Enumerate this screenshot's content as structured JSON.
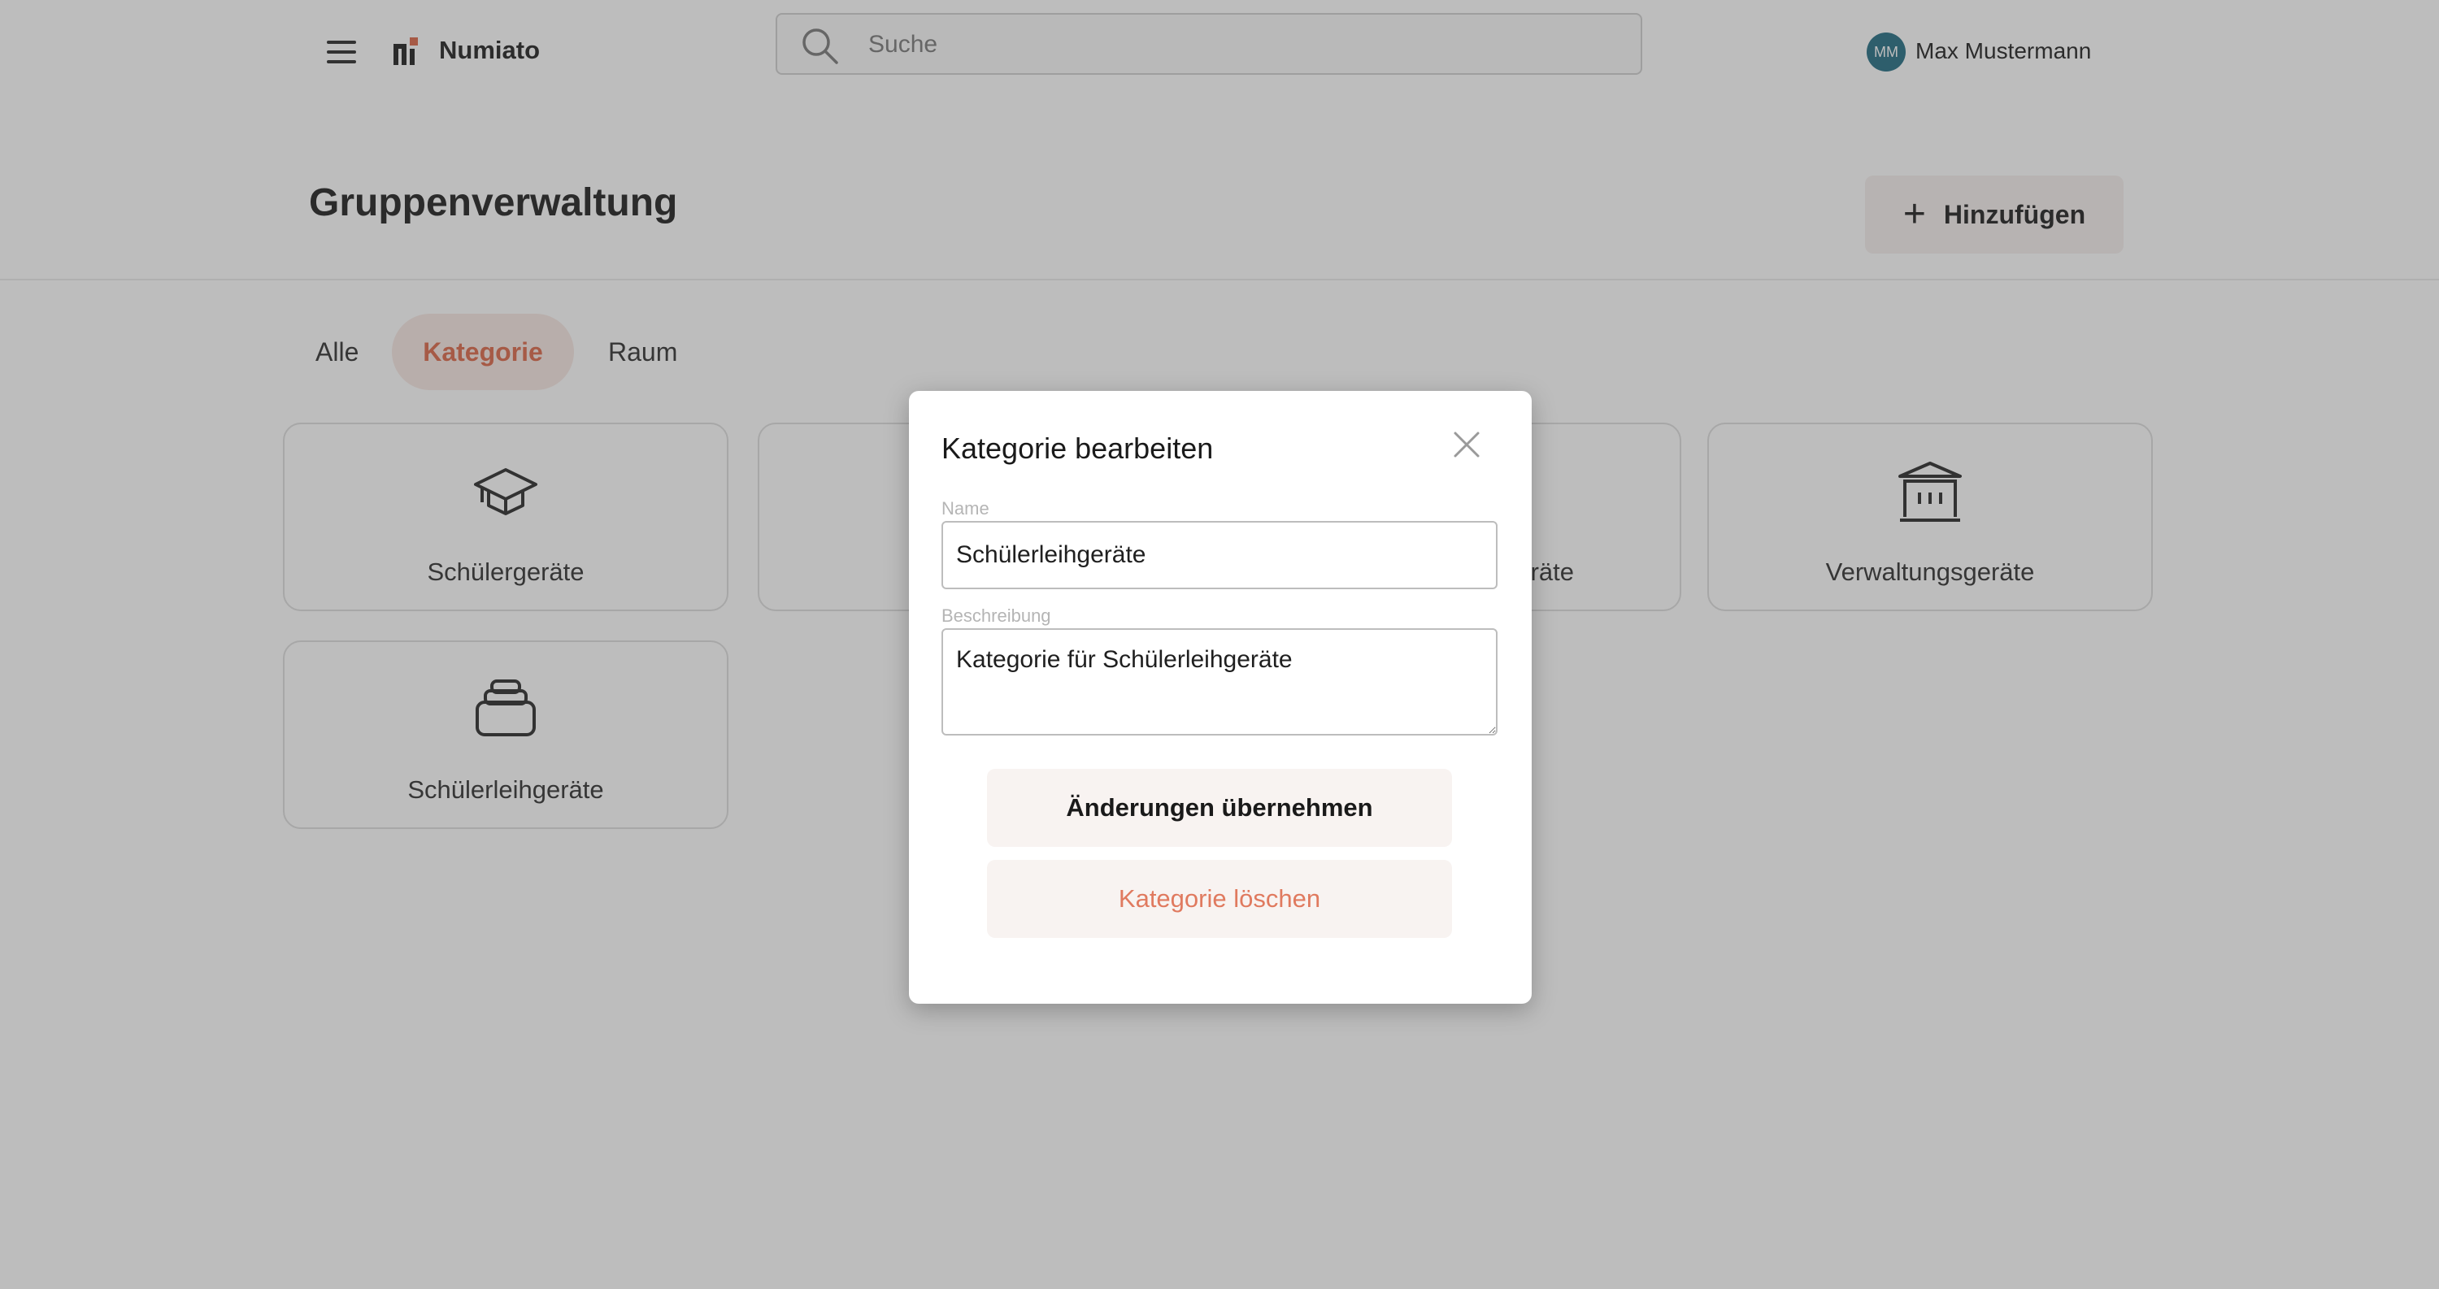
{
  "header": {
    "app_title": "Numiato",
    "search_placeholder": "Suche",
    "user": {
      "initials": "MM",
      "name": "Max Mustermann",
      "avatar_color": "#3f7f92"
    }
  },
  "page": {
    "title": "Gruppenverwaltung",
    "add_button_label": "Hinzufügen"
  },
  "tabs": [
    {
      "label": "Alle",
      "active": false
    },
    {
      "label": "Kategorie",
      "active": true
    },
    {
      "label": "Raum",
      "active": false
    }
  ],
  "cards": [
    {
      "label": "Schülergeräte",
      "icon": "graduation-cap-icon"
    },
    {
      "label": "",
      "icon": ""
    },
    {
      "label": "räte",
      "icon": ""
    },
    {
      "label": "Verwaltungsgeräte",
      "icon": "building-icon"
    },
    {
      "label": "Schülerleihgeräte",
      "icon": "device-stack-icon"
    }
  ],
  "modal": {
    "title": "Kategorie bearbeiten",
    "name_label": "Name",
    "name_value": "Schülerleihgeräte",
    "description_label": "Beschreibung",
    "description_value": "Kategorie für Schülerleihgeräte",
    "apply_label": "Änderungen übernehmen",
    "delete_label": "Kategorie löschen"
  },
  "colors": {
    "accent": "#e07a5f",
    "accent_bg": "#f9ebe7",
    "button_bg": "#f8f3f1",
    "overlay": "rgba(0,0,0,0.26)"
  }
}
